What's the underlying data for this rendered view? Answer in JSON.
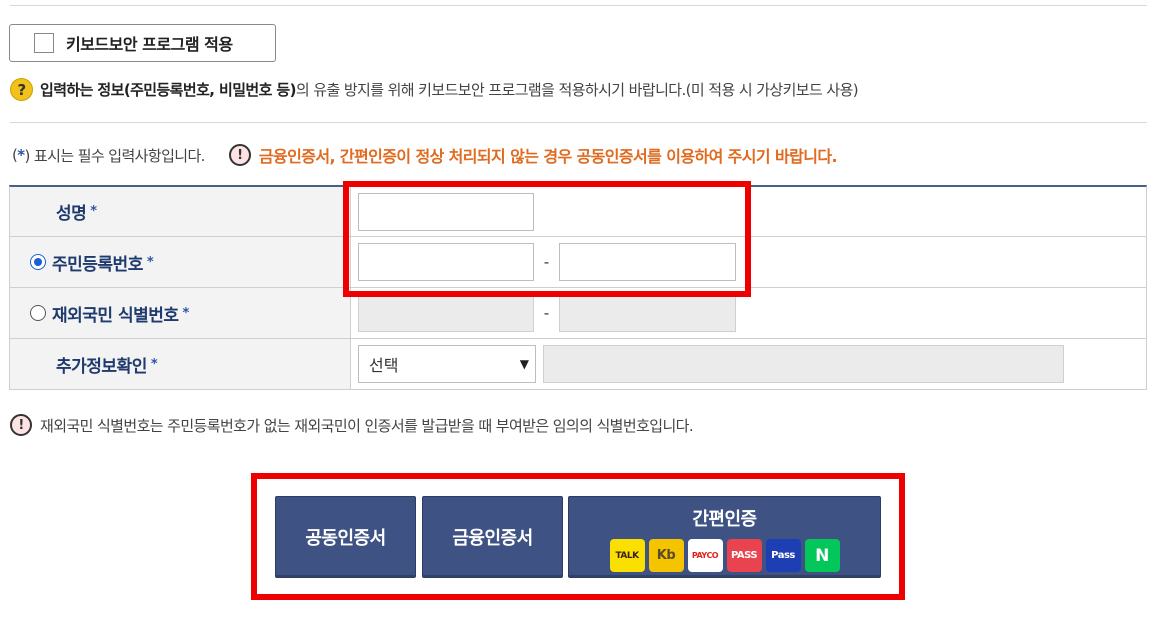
{
  "keyboard_security": {
    "label": "키보드보안 프로그램 적용",
    "checked": false
  },
  "notice": {
    "icon": "question-icon",
    "bold": "입력하는 정보(주민등록번호, 비밀번호 등)",
    "rest": "의 유출 방지를 위해 키보드보안 프로그램을 적용하시기 바랍니다.(미 적용 시 가상키보드 사용)"
  },
  "required_note": {
    "prefix": "(",
    "star": "*",
    "suffix": ") 표시는 필수 입력사항입니다.",
    "warning": "금융인증서, 간편인증이 정상 처리되지 않는 경우 공동인증서를 이용하여 주시기 바랍니다."
  },
  "form": {
    "name_label": "성명",
    "rrn_label": "주민등록번호",
    "foreign_label": "재외국민 식별번호",
    "extra_label": "추가정보확인",
    "required_mark": "*",
    "dash": "-",
    "select_value": "선택",
    "selected_id_type": "rrn"
  },
  "info_note": "재외국민 식별번호는 주민등록번호가 없는 재외국민이 인증서를 발급받을 때 부여받은 임의의 식별번호입니다.",
  "buttons": {
    "joint_cert": "공동인증서",
    "financial_cert": "금융인증서",
    "easy_auth": "간편인증",
    "easy_icons": {
      "kakao": "TALK",
      "kb": "Kb",
      "payco": "PAYCO",
      "pass": "PASS",
      "samsung_pass": "Pass",
      "naver": "N"
    }
  },
  "colors": {
    "highlight": "#ee0000",
    "button": "#3e5283",
    "label_text": "#1f3a6e",
    "warning_text": "#e06a1f"
  }
}
